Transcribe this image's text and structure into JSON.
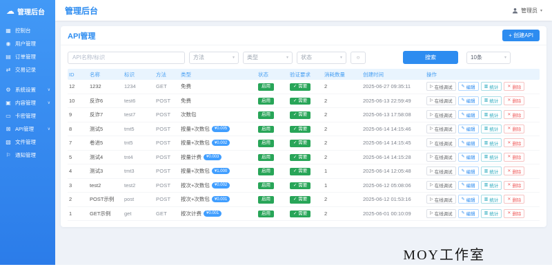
{
  "app": {
    "logo": "管理后台",
    "logo_icon_glyph": "☁",
    "header_title": "管理后台",
    "user": {
      "name": "管理员",
      "caret": "▾"
    }
  },
  "sidebar": {
    "items": [
      {
        "label": "控制台",
        "icon": "dashboard-icon",
        "glyph": "▦",
        "chevron": false,
        "group_end": false
      },
      {
        "label": "用户管理",
        "icon": "users-icon",
        "glyph": "◉",
        "chevron": false,
        "group_end": false
      },
      {
        "label": "订单管理",
        "icon": "orders-icon",
        "glyph": "▤",
        "chevron": false,
        "group_end": false
      },
      {
        "label": "交易记录",
        "icon": "transactions-icon",
        "glyph": "⇄",
        "chevron": false,
        "group_end": true
      },
      {
        "label": "系统设置",
        "icon": "settings-gear-icon",
        "glyph": "⚙",
        "chevron": true,
        "group_end": false
      },
      {
        "label": "内容管理",
        "icon": "content-icon",
        "glyph": "▣",
        "chevron": true,
        "group_end": false
      },
      {
        "label": "卡密管理",
        "icon": "card-icon",
        "glyph": "▭",
        "chevron": false,
        "group_end": false
      },
      {
        "label": "API管理",
        "icon": "api-icon",
        "glyph": "⊠",
        "chevron": true,
        "group_end": false
      },
      {
        "label": "文件管理",
        "icon": "files-icon",
        "glyph": "▧",
        "chevron": false,
        "group_end": false
      },
      {
        "label": "通知管理",
        "icon": "notify-icon",
        "glyph": "⚐",
        "chevron": false,
        "group_end": false
      }
    ],
    "chevron_glyph": "∨"
  },
  "page": {
    "title": "API管理",
    "create_button": "+ 创建API",
    "filters": {
      "keyword_placeholder": "API名称/标识",
      "method_placeholder": "方法",
      "type_placeholder": "类型",
      "status_placeholder": "状态",
      "reset_glyph": "○",
      "search_button": "搜索",
      "page_size": "10条",
      "caret_glyph": "▾"
    },
    "table": {
      "columns": [
        "ID",
        "名称",
        "标识",
        "方法",
        "类型",
        "状态",
        "验证要求",
        "消耗数量",
        "创建时间",
        "操作"
      ],
      "status_label": "启用",
      "verify_label": "✓ 需要",
      "rows": [
        {
          "id": "12",
          "name": "1232",
          "code": "1234",
          "method": "GET",
          "type": "免费",
          "price": "",
          "quota": "2",
          "created": "2025-06-27 09:35:11"
        },
        {
          "id": "10",
          "name": "反诈6",
          "code": "test6",
          "method": "POST",
          "type": "免费",
          "price": "",
          "quota": "2",
          "created": "2025-06-13 22:59:49"
        },
        {
          "id": "9",
          "name": "反诈7",
          "code": "test7",
          "method": "POST",
          "type": "次数包",
          "price": "",
          "quota": "2",
          "created": "2025-06-13 17:58:08"
        },
        {
          "id": "8",
          "name": "测试5",
          "code": "tmt5",
          "method": "POST",
          "type": "按量+次数包",
          "price": "¥0.005",
          "quota": "2",
          "created": "2025-06-14 14:15:46"
        },
        {
          "id": "7",
          "name": "卷进5",
          "code": "tnt5",
          "method": "POST",
          "type": "按量+次数包",
          "price": "¥0.002",
          "quota": "2",
          "created": "2025-06-14 14:15:45"
        },
        {
          "id": "5",
          "name": "测试4",
          "code": "tnt4",
          "method": "POST",
          "type": "按量计费",
          "price": "¥0.003",
          "quota": "2",
          "created": "2025-06-14 14:15:28"
        },
        {
          "id": "4",
          "name": "测试3",
          "code": "tmt3",
          "method": "POST",
          "type": "按量+次数包",
          "price": "¥1.000",
          "quota": "1",
          "created": "2025-06-14 12:05:48"
        },
        {
          "id": "3",
          "name": "test2",
          "code": "test2",
          "method": "POST",
          "type": "按次+次数包",
          "price": "¥0.002",
          "quota": "1",
          "created": "2025-06-12 05:08:06"
        },
        {
          "id": "2",
          "name": "POST示例",
          "code": "post",
          "method": "POST",
          "type": "按次+次数包",
          "price": "¥0.001",
          "quota": "2",
          "created": "2025-06-12 01:53:16"
        },
        {
          "id": "1",
          "name": "GET示例",
          "code": "get",
          "method": "GET",
          "type": "按次计费",
          "price": "¥0.001",
          "quota": "2",
          "created": "2025-06-01 00:10:09"
        }
      ]
    },
    "row_actions": [
      {
        "label": "在线调试",
        "name": "debug-button",
        "style": "default",
        "glyph": "▷"
      },
      {
        "label": "编辑",
        "name": "edit-button",
        "style": "primary",
        "glyph": "✎"
      },
      {
        "label": "统计",
        "name": "stats-button",
        "style": "info",
        "glyph": "▥"
      },
      {
        "label": "删除",
        "name": "delete-button",
        "style": "danger",
        "glyph": "✕"
      }
    ]
  },
  "footer": {
    "watermark": "MOY工作室"
  },
  "colors": {
    "primary": "#2d8cf0",
    "success": "#28a558",
    "price_badge": "#409eff",
    "table_header_bg": "#e9f4fe"
  }
}
